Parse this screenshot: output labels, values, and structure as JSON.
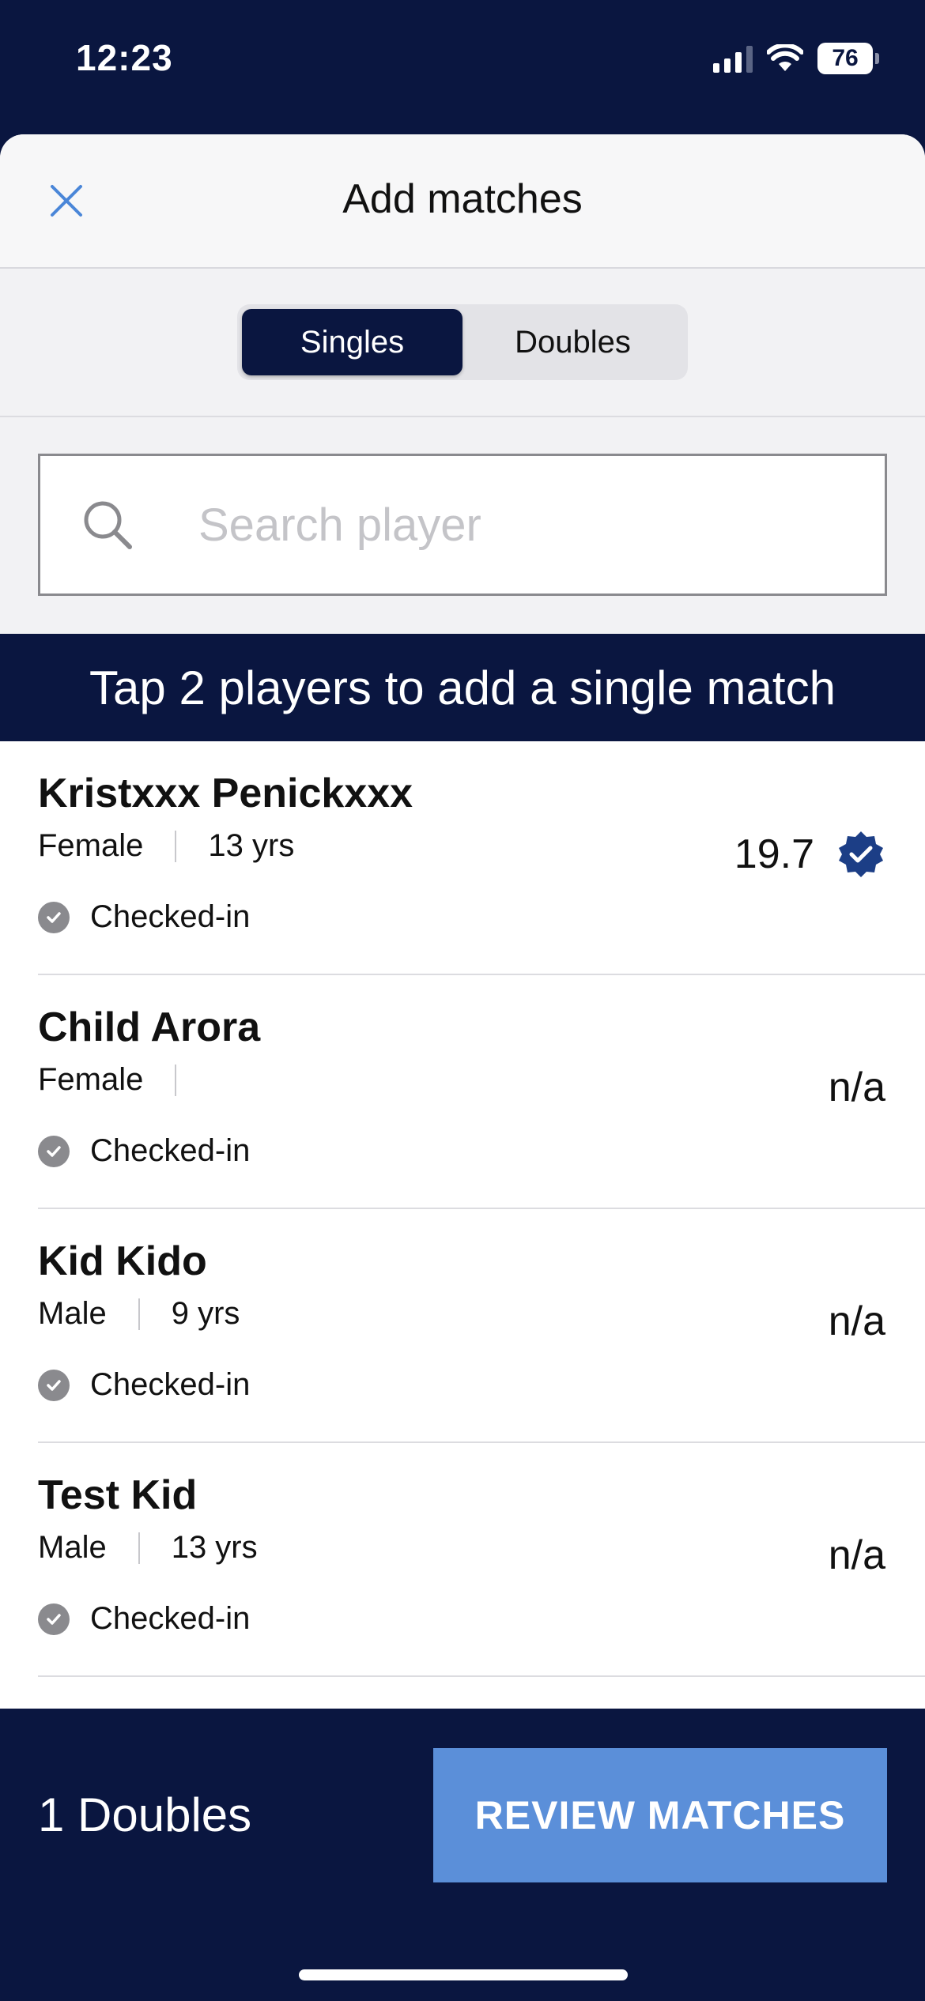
{
  "status_bar": {
    "time": "12:23",
    "battery": "76",
    "icons": [
      "signal-icon",
      "wifi-icon",
      "battery-icon"
    ]
  },
  "header": {
    "title": "Add matches",
    "close_icon": "close-icon"
  },
  "segments": {
    "selected": "Singles",
    "items": [
      {
        "label": "Singles"
      },
      {
        "label": "Doubles"
      }
    ]
  },
  "search": {
    "placeholder": "Search player",
    "value": ""
  },
  "instruction": "Tap 2 players to add a single match",
  "players": [
    {
      "name": "Kristxxx Penickxxx",
      "gender": "Female",
      "age": "13 yrs",
      "status": "Checked-in",
      "rating": "19.7",
      "verified": true
    },
    {
      "name": "Child Arora",
      "gender": "Female",
      "age": "",
      "status": "Checked-in",
      "rating": "n/a",
      "verified": false
    },
    {
      "name": "Kid Kido",
      "gender": "Male",
      "age": "9 yrs",
      "status": "Checked-in",
      "rating": "n/a",
      "verified": false
    },
    {
      "name": "Test Kid",
      "gender": "Male",
      "age": "13 yrs",
      "status": "Checked-in",
      "rating": "n/a",
      "verified": false
    }
  ],
  "footer": {
    "count_label": "1 Doubles",
    "review_button": "REVIEW MATCHES"
  },
  "colors": {
    "navy": "#0a1640",
    "accent_blue": "#5b8fd9",
    "close_blue": "#4a86d8",
    "check_gray": "#8a8a8e",
    "verified_blue": "#1c3e86"
  }
}
